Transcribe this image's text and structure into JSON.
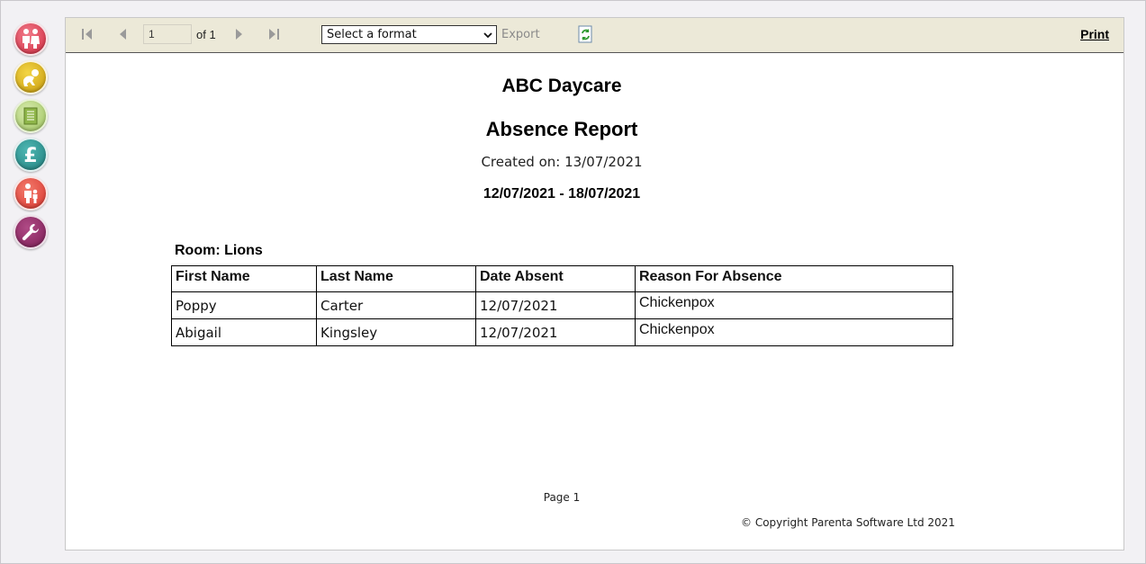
{
  "sidebar": {
    "items": [
      {
        "name": "parents",
        "icon": "parents-icon"
      },
      {
        "name": "children",
        "icon": "crawling-baby-icon"
      },
      {
        "name": "reports",
        "icon": "report-icon"
      },
      {
        "name": "finance",
        "icon": "pound-icon"
      },
      {
        "name": "family",
        "icon": "family-icon"
      },
      {
        "name": "settings",
        "icon": "wrench-icon"
      }
    ]
  },
  "toolbar": {
    "page_value": "1",
    "page_of": "of 1",
    "format_placeholder": "Select a format",
    "export_label": "Export",
    "print_label": "Print"
  },
  "report": {
    "company": "ABC Daycare",
    "title": "Absence Report",
    "created": "Created on: 13/07/2021",
    "date_range": "12/07/2021 - 18/07/2021",
    "room": "Room: Lions",
    "columns": [
      "First Name",
      "Last Name",
      "Date Absent",
      "Reason For Absence"
    ],
    "rows": [
      {
        "first": "Poppy",
        "last": "Carter",
        "date": "12/07/2021",
        "reason": "Chickenpox"
      },
      {
        "first": "Abigail",
        "last": "Kingsley",
        "date": "12/07/2021",
        "reason": "Chickenpox"
      }
    ],
    "page_label": "Page 1",
    "copyright": "© Copyright Parenta Software Ltd 2021"
  },
  "colors": {
    "toolbar_bg": "#ece9d8",
    "page_bg": "#f2f1f4",
    "export_disabled": "#8a8a8a"
  }
}
